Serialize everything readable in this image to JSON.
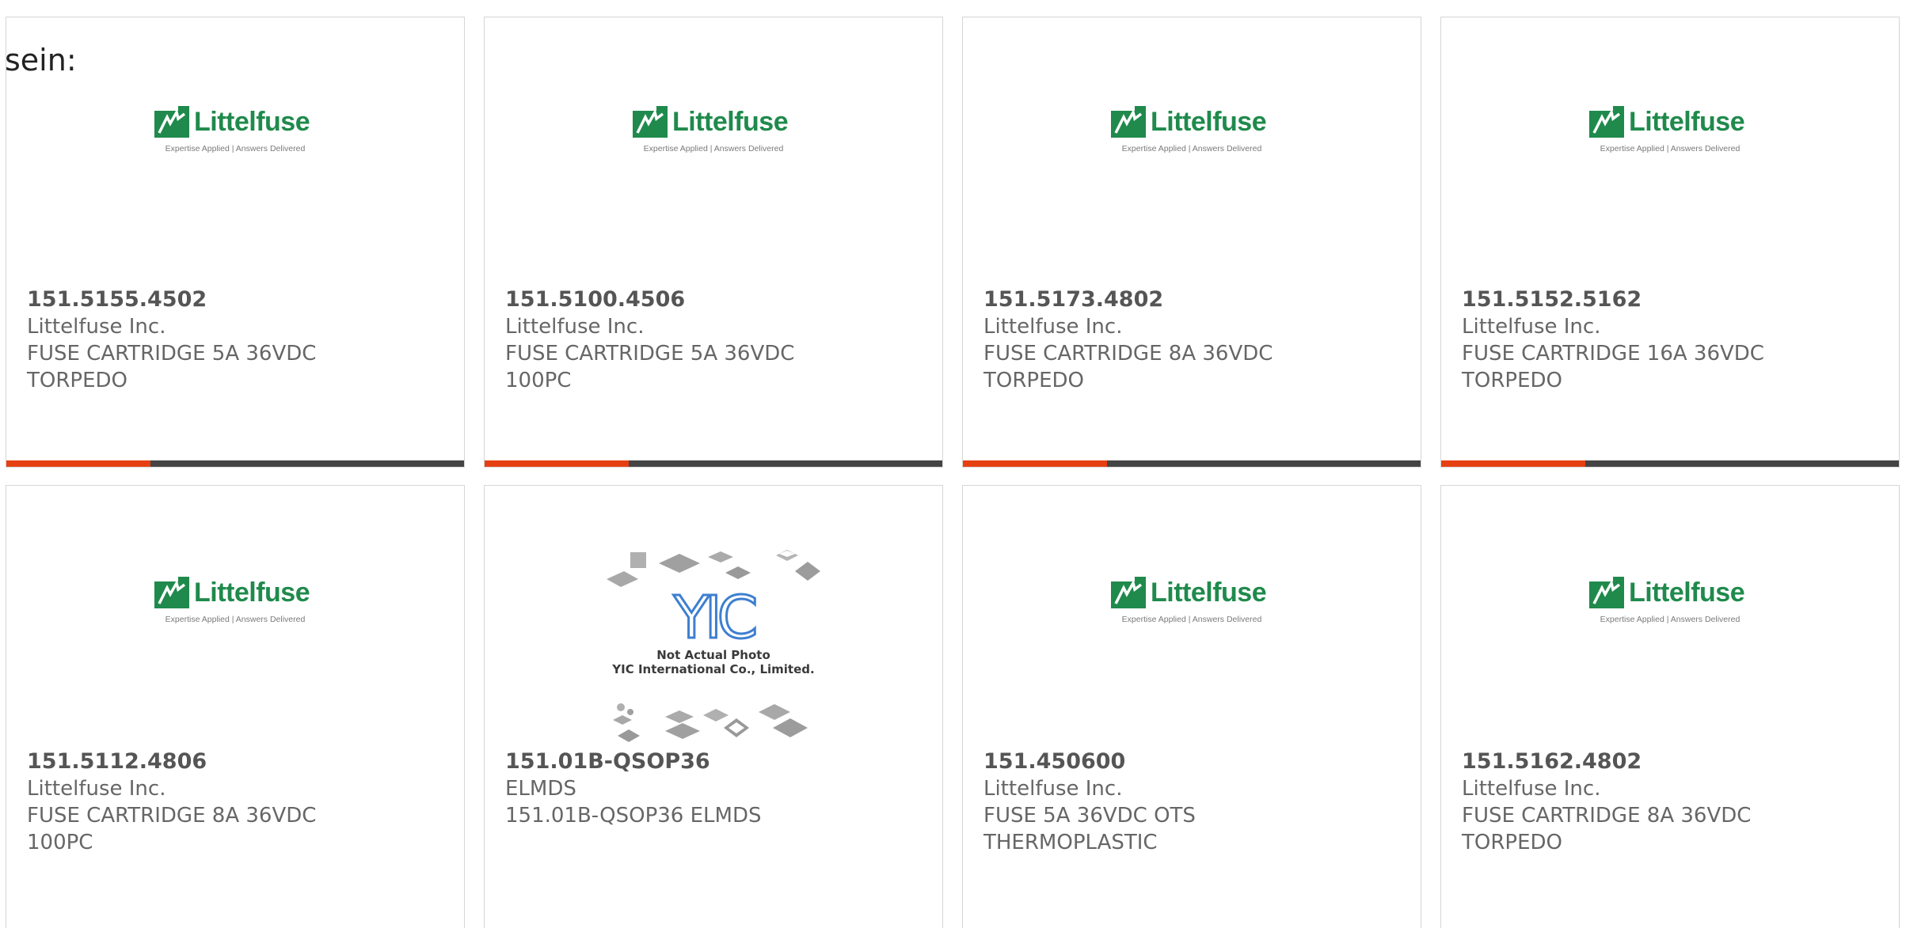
{
  "intro_text": "sein:",
  "colors": {
    "accent": "#e64012",
    "bar_dark": "#444444",
    "littelfuse_green": "#1f8a4c"
  },
  "products": [
    {
      "part_number": "151.5155.4502",
      "manufacturer": "Littelfuse Inc.",
      "description_line1": "FUSE CARTRIDGE 5A 36VDC",
      "description_line2": "TORPEDO",
      "image": "littelfuse-logo",
      "logo_brand": "Littelfuse",
      "logo_tagline": "Expertise Applied | Answers Delivered"
    },
    {
      "part_number": "151.5100.4506",
      "manufacturer": "Littelfuse Inc.",
      "description_line1": "FUSE CARTRIDGE 5A 36VDC",
      "description_line2": "100PC",
      "image": "littelfuse-logo",
      "logo_brand": "Littelfuse",
      "logo_tagline": "Expertise Applied | Answers Delivered"
    },
    {
      "part_number": "151.5173.4802",
      "manufacturer": "Littelfuse Inc.",
      "description_line1": "FUSE CARTRIDGE 8A 36VDC",
      "description_line2": "TORPEDO",
      "image": "littelfuse-logo",
      "logo_brand": "Littelfuse",
      "logo_tagline": "Expertise Applied | Answers Delivered"
    },
    {
      "part_number": "151.5152.5162",
      "manufacturer": "Littelfuse Inc.",
      "description_line1": "FUSE CARTRIDGE 16A 36VDC",
      "description_line2": "TORPEDO",
      "image": "littelfuse-logo",
      "logo_brand": "Littelfuse",
      "logo_tagline": "Expertise Applied | Answers Delivered"
    },
    {
      "part_number": "151.5112.4806",
      "manufacturer": "Littelfuse Inc.",
      "description_line1": "FUSE CARTRIDGE 8A 36VDC",
      "description_line2": "100PC",
      "image": "littelfuse-logo",
      "logo_brand": "Littelfuse",
      "logo_tagline": "Expertise Applied | Answers Delivered"
    },
    {
      "part_number": "151.01B-QSOP36",
      "manufacturer": "ELMDS",
      "description_line1": "151.01B-QSOP36 ELMDS",
      "description_line2": "",
      "image": "yic-placeholder",
      "placeholder_line1": "Not Actual Photo",
      "placeholder_line2": "YIC International Co., Limited."
    },
    {
      "part_number": "151.450600",
      "manufacturer": "Littelfuse Inc.",
      "description_line1": "FUSE 5A 36VDC OTS",
      "description_line2": "THERMOPLASTIC",
      "image": "littelfuse-logo",
      "logo_brand": "Littelfuse",
      "logo_tagline": "Expertise Applied | Answers Delivered"
    },
    {
      "part_number": "151.5162.4802",
      "manufacturer": "Littelfuse Inc.",
      "description_line1": "FUSE CARTRIDGE 8A 36VDC",
      "description_line2": "TORPEDO",
      "image": "littelfuse-logo",
      "logo_brand": "Littelfuse",
      "logo_tagline": "Expertise Applied | Answers Delivered"
    }
  ]
}
